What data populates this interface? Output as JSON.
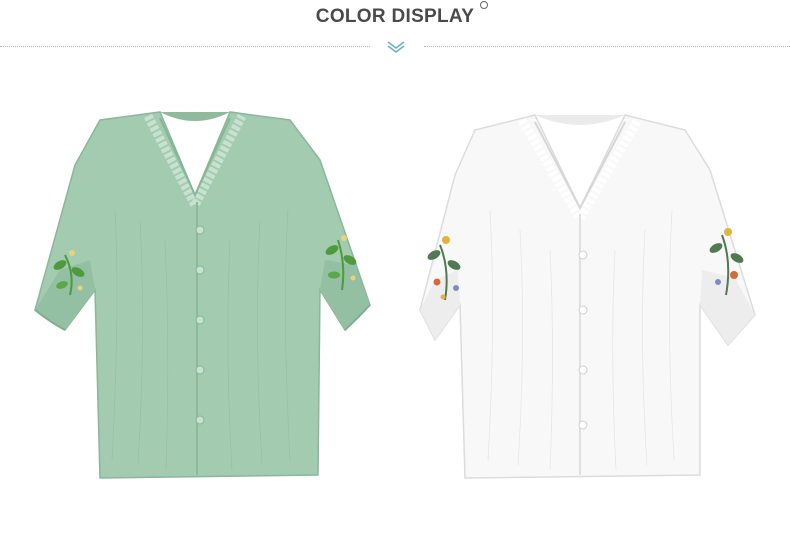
{
  "header": {
    "title": "COLOR DISPLAY"
  },
  "products": [
    {
      "name": "green-blouse",
      "color": "#9fc8ae",
      "shade": "#86b597",
      "embroidery": [
        "#4f9a3e",
        "#e8d27a"
      ]
    },
    {
      "name": "white-blouse",
      "color": "#f7f7f7",
      "shade": "#e4e4e4",
      "embroidery": [
        "#4f7a52",
        "#e3b43a",
        "#d46a3a",
        "#7a8fb8"
      ]
    }
  ],
  "colors": {
    "title_text": "#4a4a4a",
    "divider": "#b8b8b8",
    "chevron": "#6ab3c7"
  }
}
